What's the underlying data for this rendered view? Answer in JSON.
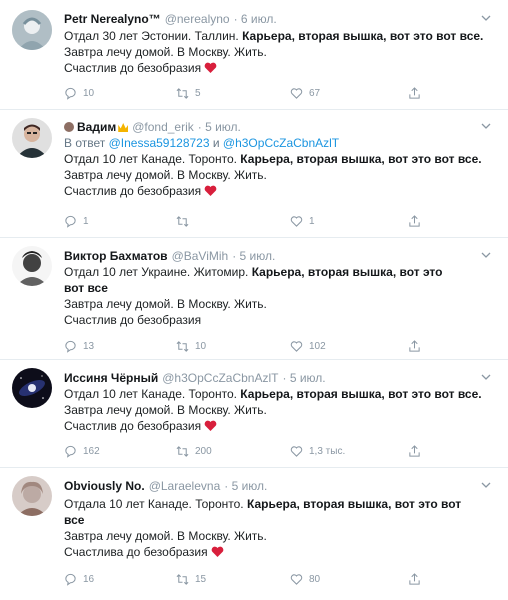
{
  "tweets": [
    {
      "name": "Petr Nerealyno™",
      "handle": "@nerealyno",
      "date": "· 6 июл.",
      "line1_plain": "Отдал 30 лет Эстонии. Таллин. ",
      "line1_bold": "Карьера, вторая вышка, вот это вот все.",
      "line2": "Завтра лечу домой. В Москву. Жить.",
      "line3": "Счастлив до безобразия",
      "replies": "10",
      "retweets": "5",
      "likes": "67"
    },
    {
      "name": "Вадим",
      "handle": "@fond_erik",
      "date": "· 5 июл.",
      "reply_prefix": "В ответ ",
      "reply_user1": "@Inessa59128723",
      "reply_and": " и ",
      "reply_user2": "@h3OpCcZaCbnAzlT",
      "line1_plain": "Отдал 10 лет Канаде. Торонто. ",
      "line1_bold": "Карьера, вторая вышка, вот это вот все.",
      "line2": "Завтра лечу домой. В Москву. Жить.",
      "line3": "Счастлив до безобразия",
      "replies": "1",
      "retweets": "",
      "likes": "1"
    },
    {
      "name": "Виктор Бахматов",
      "handle": "@BaViMih",
      "date": "· 5 июл.",
      "line1_plain": "Отдал 10 лет Украине. Житомир. ",
      "line1_bold": "Карьера, вторая вышка, вот это вот все",
      "line2": "Завтра лечу домой. В Москву. Жить.",
      "line3": "Счастлив до безобразия",
      "replies": "13",
      "retweets": "10",
      "likes": "102"
    },
    {
      "name": "Иссиня Чёрный",
      "handle": "@h3OpCcZaCbnAzlT",
      "date": "· 5 июл.",
      "line1_plain": "Отдал 10 лет Канаде. Торонто. ",
      "line1_bold": "Карьера, вторая вышка, вот это вот все.",
      "line2": "Завтра лечу домой. В Москву. Жить.",
      "line3": "Счастлив до безобразия",
      "replies": "162",
      "retweets": "200",
      "likes": "1,3 тыс."
    },
    {
      "name": "Obviously No.",
      "handle": "@Laraelevna",
      "date": "· 5 июл.",
      "line1_plain": "Отдала 10 лет Канаде. Торонто. ",
      "line1_bold": "Карьера, вторая вышка, вот это вот все",
      "line2": "Завтра лечу домой. В Москву. Жить.",
      "line3": "Счастлива до безобразия",
      "replies": "16",
      "retweets": "15",
      "likes": "80"
    }
  ],
  "icons": {
    "reply": "reply-icon",
    "retweet": "retweet-icon",
    "like": "heart-icon",
    "share": "share-icon",
    "more": "chevron-down-icon"
  },
  "colors": {
    "link": "#1b95e0",
    "meta": "#8a97a3",
    "heart_emoji": "#d81f3c",
    "divider": "#e6ecf0"
  }
}
